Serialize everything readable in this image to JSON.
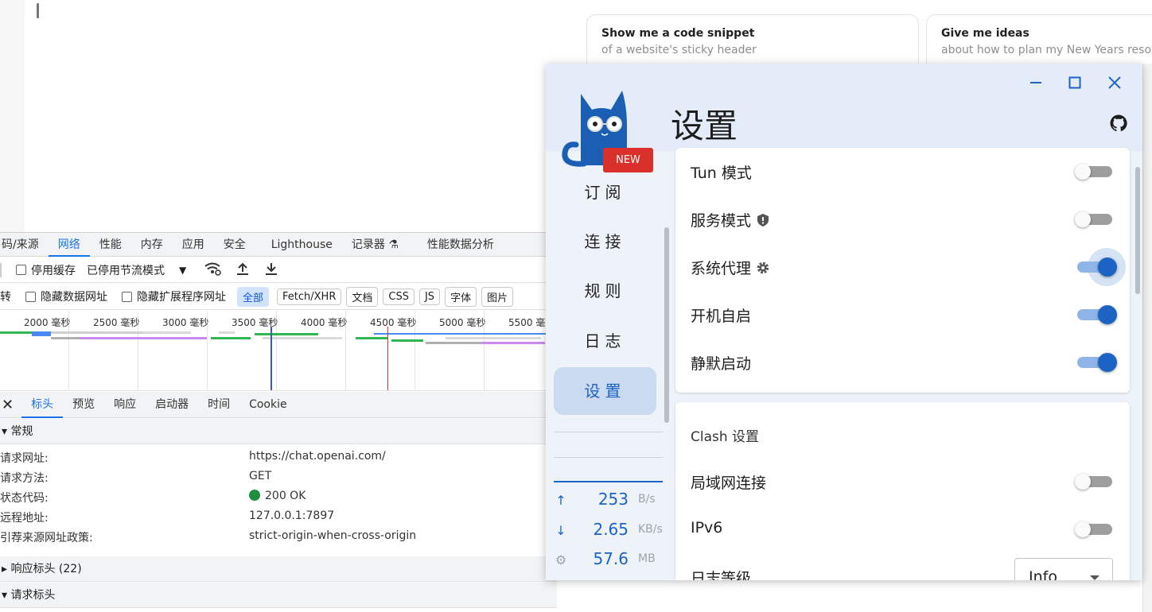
{
  "chat": {
    "suggestions": [
      {
        "title": "Show me a code snippet",
        "subtitle": "of a website's sticky header"
      },
      {
        "title": "Give me ideas",
        "subtitle": "about how to plan my New Years resol"
      }
    ]
  },
  "devtools": {
    "tabs": [
      "码/来源",
      "网络",
      "性能",
      "内存",
      "应用",
      "安全",
      "Lighthouse",
      "记录器",
      "性能数据分析"
    ],
    "active_tab": "网络",
    "toolbar": {
      "disable_cache": "停用缓存",
      "throttle": "已停用节流模式"
    },
    "filters": {
      "invert": "转",
      "hide_data_urls": "隐藏数据网址",
      "hide_ext_urls": "隐藏扩展程序网址",
      "types": [
        "全部",
        "Fetch/XHR",
        "文档",
        "CSS",
        "JS",
        "字体",
        "图片"
      ]
    },
    "timeline_ticks": [
      "2000 毫秒",
      "2500 毫秒",
      "3000 毫秒",
      "3500 毫秒",
      "4000 毫秒",
      "4500 毫秒",
      "5000 毫秒",
      "5500 毫秒"
    ],
    "detail_tabs": [
      "标头",
      "预览",
      "响应",
      "启动器",
      "时间",
      "Cookie"
    ],
    "general": {
      "title": "▾ 常规",
      "rows": [
        {
          "key": "请求网址:",
          "value": "https://chat.openai.com/"
        },
        {
          "key": "请求方法:",
          "value": "GET"
        },
        {
          "key": "状态代码:",
          "value": "200 OK"
        },
        {
          "key": "远程地址:",
          "value": "127.0.0.1:7897"
        },
        {
          "key": "引荐来源网址政策:",
          "value": "strict-origin-when-cross-origin"
        }
      ]
    },
    "response_headers": "▸ 响应标头 (22)",
    "request_headers": "▾ 请求标头",
    "status_color": "#1e8e3e"
  },
  "clash": {
    "title": "设置",
    "badge": "NEW",
    "nav": [
      "订阅",
      "连接",
      "规则",
      "日志",
      "设置"
    ],
    "active_nav": "设置",
    "traffic": {
      "up_value": "253",
      "up_unit": "B/s",
      "down_value": "2.65",
      "down_unit": "KB/s",
      "mem_value": "57.6",
      "mem_unit": "MB"
    },
    "system_settings": [
      {
        "label": "Tun 模式",
        "on": false
      },
      {
        "label": "服务模式",
        "on": false,
        "icon": "shield-icon"
      },
      {
        "label": "系统代理",
        "on": true,
        "icon": "gear-icon"
      },
      {
        "label": "开机自启",
        "on": true
      },
      {
        "label": "静默启动",
        "on": true
      }
    ],
    "clash_settings_title": "Clash 设置",
    "clash_settings": [
      {
        "label": "局域网连接",
        "on": false
      },
      {
        "label": "IPv6",
        "on": false
      }
    ],
    "log_level_label": "日志等级",
    "log_level_value": "Info",
    "accent": "#1c63c4"
  }
}
